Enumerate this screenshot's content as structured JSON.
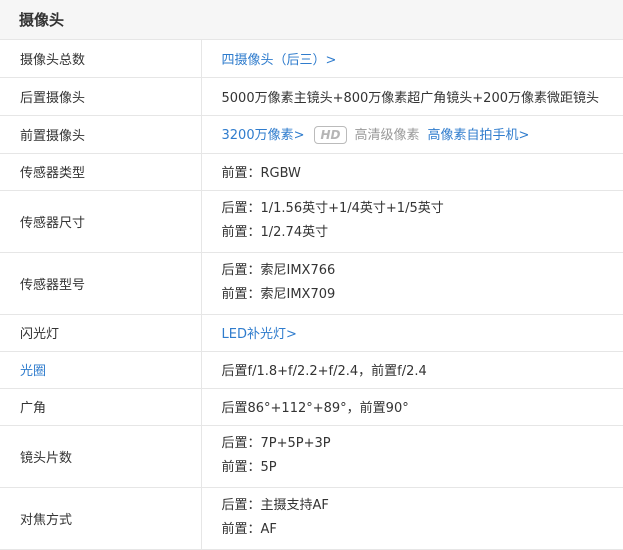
{
  "section": {
    "title": "摄像头"
  },
  "rows": {
    "total": {
      "key": "摄像头总数",
      "value": "四摄像头（后三）>"
    },
    "rear": {
      "key": "后置摄像头",
      "value": "5000万像素主镜头+800万像素超广角镜头+200万像素微距镜头"
    },
    "front": {
      "key": "前置摄像头",
      "value": "3200万像素>",
      "badge": "HD",
      "quality": "高清级像素",
      "link": "高像素自拍手机>"
    },
    "sensor_type": {
      "key": "传感器类型",
      "value": "前置：RGBW"
    },
    "sensor_size": {
      "key": "传感器尺寸",
      "line1": "后置：1/1.56英寸+1/4英寸+1/5英寸",
      "line2": "前置：1/2.74英寸"
    },
    "sensor_model": {
      "key": "传感器型号",
      "line1": "后置：索尼IMX766",
      "line2": "前置：索尼IMX709"
    },
    "flash": {
      "key": "闪光灯",
      "value": "LED补光灯>"
    },
    "aperture": {
      "key": "光圈",
      "value": "后置f/1.8+f/2.2+f/2.4，前置f/2.4"
    },
    "wide": {
      "key": "广角",
      "value": "后置86°+112°+89°，前置90°"
    },
    "lens": {
      "key": "镜头片数",
      "line1": "后置：7P+5P+3P",
      "line2": "前置：5P"
    },
    "focus": {
      "key": "对焦方式",
      "line1": "后置：主摄支持AF",
      "line2": "前置：AF"
    }
  },
  "colors": {
    "link": "#2f7ccd",
    "muted": "#999999",
    "border": "#e6e6e6",
    "header_bg": "#f6f6f6"
  }
}
